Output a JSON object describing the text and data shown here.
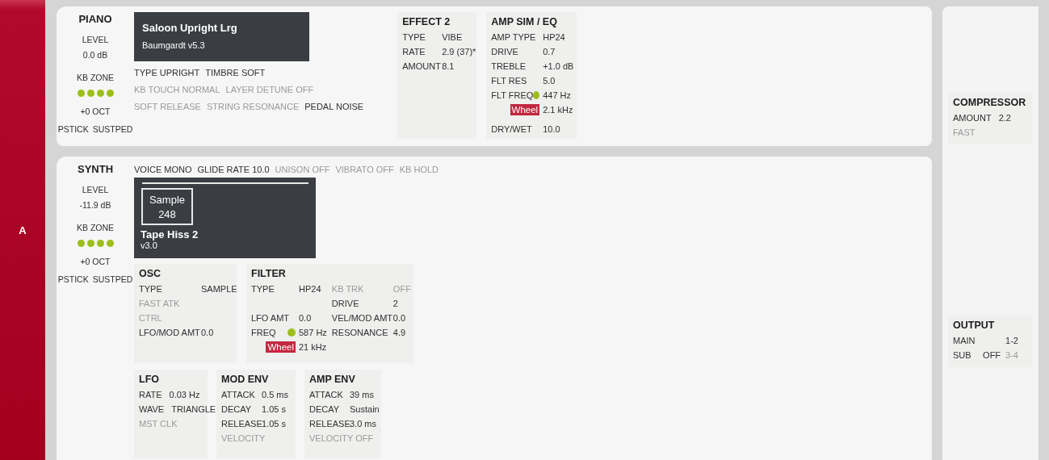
{
  "side_label": "A",
  "piano": {
    "title": "PIANO",
    "level_label": "LEVEL",
    "level_value": "0.0 dB",
    "kb_zone_label": "KB ZONE",
    "kb_zone": [
      {
        "on": true
      },
      {
        "on": true
      },
      {
        "on": true
      },
      {
        "on": true
      }
    ],
    "octave": "+0 OCT",
    "pedals": [
      {
        "label": "PSTICK",
        "enabled": true
      },
      {
        "label": "SUSTPED",
        "enabled": true
      }
    ],
    "program": {
      "name": "Saloon Upright Lrg",
      "version": "Baumgardt v5.3"
    },
    "options": [
      [
        {
          "label": "TYPE UPRIGHT",
          "enabled": true
        },
        {
          "label": "TIMBRE SOFT",
          "enabled": true
        }
      ],
      [
        {
          "label": "KB TOUCH NORMAL",
          "enabled": false
        },
        {
          "label": "LAYER DETUNE OFF",
          "enabled": false
        }
      ],
      [
        {
          "label": "SOFT RELEASE",
          "enabled": false
        },
        {
          "label": "STRING RESONANCE",
          "enabled": false
        },
        {
          "label": "PEDAL NOISE",
          "enabled": true
        }
      ]
    ],
    "sections": [
      {
        "title": "EFFECT 2",
        "columns": [
          [
            {
              "kind": "param",
              "label": "TYPE",
              "value": "VIBE",
              "enabled": true
            },
            {
              "kind": "param",
              "label": "RATE",
              "value": "2.9 (37)*",
              "enabled": true
            },
            {
              "kind": "param",
              "label": "AMOUNT",
              "value": "8.1",
              "enabled": true
            }
          ]
        ]
      },
      {
        "title": "AMP SIM / EQ",
        "columns": [
          [
            {
              "kind": "param",
              "label": "AMP TYPE",
              "value": "HP24",
              "enabled": true
            },
            {
              "kind": "param",
              "label": "DRIVE",
              "value": "0.7",
              "enabled": true
            },
            {
              "kind": "param",
              "label": "TREBLE",
              "value": "+1.0 dB",
              "enabled": true
            },
            {
              "kind": "param",
              "label": "FLT RES",
              "value": "5.0",
              "enabled": true
            },
            {
              "kind": "morph",
              "label": "FLT FREQ",
              "value": "447 Hz",
              "enabled": true
            },
            {
              "kind": "wheel",
              "label": "Wheel",
              "value": "2.1 kHz",
              "enabled": true
            },
            {
              "kind": "param",
              "label": "DRY/WET",
              "value": "10.0",
              "enabled": true
            }
          ]
        ]
      }
    ]
  },
  "synth": {
    "title": "SYNTH",
    "level_label": "LEVEL",
    "level_value": "-11.9 dB",
    "kb_zone_label": "KB ZONE",
    "kb_zone": [
      {
        "on": true
      },
      {
        "on": true
      },
      {
        "on": true
      },
      {
        "on": true
      }
    ],
    "octave": "+0 OCT",
    "pedals": [
      {
        "label": "PSTICK",
        "enabled": true
      },
      {
        "label": "SUSTPED",
        "enabled": true
      }
    ],
    "voice_options": [
      {
        "label": "VOICE MONO",
        "enabled": true
      },
      {
        "label": "GLIDE RATE 10.0",
        "enabled": true
      },
      {
        "label": "UNISON OFF",
        "enabled": false
      },
      {
        "label": "VIBRATO OFF",
        "enabled": false
      },
      {
        "label": "KB HOLD",
        "enabled": false
      }
    ],
    "program": {
      "sample_label": "Sample",
      "sample_number": "248",
      "name": "Tape Hiss 2",
      "version": "v3.0"
    },
    "upper_sections": [
      {
        "title": "OSC",
        "columns": [
          [
            {
              "kind": "param",
              "label": "TYPE",
              "value": "SAMPLE",
              "enabled": true
            },
            {
              "kind": "param",
              "label": "FAST ATK",
              "enabled": false
            },
            {
              "kind": "param",
              "label": "CTRL",
              "enabled": false
            },
            {
              "kind": "param",
              "label": "LFO/MOD AMT",
              "value": "0.0",
              "enabled": true
            }
          ]
        ]
      },
      {
        "title": "FILTER",
        "columns": [
          [
            {
              "kind": "param",
              "label": "TYPE",
              "value": "HP24",
              "enabled": true
            },
            {
              "kind": "spacer"
            },
            {
              "kind": "param",
              "label": "LFO AMT",
              "value": "0.0",
              "enabled": true
            },
            {
              "kind": "morph",
              "label": "FREQ",
              "value": "587 Hz",
              "enabled": true
            },
            {
              "kind": "wheel",
              "label": "Wheel",
              "value": "21 kHz",
              "enabled": true
            }
          ],
          [
            {
              "kind": "param",
              "label": "KB TRK",
              "value": "OFF",
              "enabled": false
            },
            {
              "kind": "param",
              "label": "DRIVE",
              "value": "2",
              "enabled": true
            },
            {
              "kind": "param",
              "label": "VEL/MOD AMT",
              "value": "0.0",
              "enabled": true
            },
            {
              "kind": "param",
              "label": "RESONANCE",
              "value": "4.9",
              "enabled": true
            }
          ]
        ]
      }
    ],
    "lower_sections": [
      {
        "title": "LFO",
        "columns": [
          [
            {
              "kind": "param",
              "label": "RATE",
              "value": "0.03 Hz",
              "enabled": true
            },
            {
              "kind": "param",
              "label": "WAVE",
              "value": "TRIANGLE",
              "enabled": true
            },
            {
              "kind": "param",
              "label": "MST CLK",
              "enabled": false
            }
          ]
        ]
      },
      {
        "title": "MOD ENV",
        "columns": [
          [
            {
              "kind": "param",
              "label": "ATTACK",
              "value": "0.5 ms",
              "enabled": true
            },
            {
              "kind": "param",
              "label": "DECAY",
              "value": "1.05 s",
              "enabled": true
            },
            {
              "kind": "param",
              "label": "RELEASE",
              "value": "1.05 s",
              "enabled": true
            },
            {
              "kind": "param",
              "label": "VELOCITY",
              "enabled": false
            }
          ]
        ]
      },
      {
        "title": "AMP ENV",
        "columns": [
          [
            {
              "kind": "param",
              "label": "ATTACK",
              "value": "39 ms",
              "enabled": true
            },
            {
              "kind": "param",
              "label": "DECAY",
              "value": "Sustain",
              "enabled": true
            },
            {
              "kind": "param",
              "label": "RELEASE",
              "value": "3.0 ms",
              "enabled": true
            },
            {
              "kind": "param",
              "label": "VELOCITY OFF",
              "enabled": false
            }
          ]
        ]
      }
    ]
  },
  "compressor": {
    "title": "COMPRESSOR",
    "columns": [
      [
        {
          "kind": "param",
          "label": "AMOUNT",
          "value": "2.2",
          "enabled": true
        },
        {
          "kind": "param",
          "label": "FAST",
          "enabled": false
        }
      ]
    ]
  },
  "output": {
    "title": "OUTPUT",
    "rows": [
      {
        "label": "MAIN",
        "values": [
          {
            "text": "1-2",
            "enabled": true
          }
        ]
      },
      {
        "label": "SUB",
        "values": [
          {
            "text": "OFF",
            "enabled": true
          },
          {
            "text": "3-4",
            "enabled": false
          }
        ]
      }
    ]
  }
}
